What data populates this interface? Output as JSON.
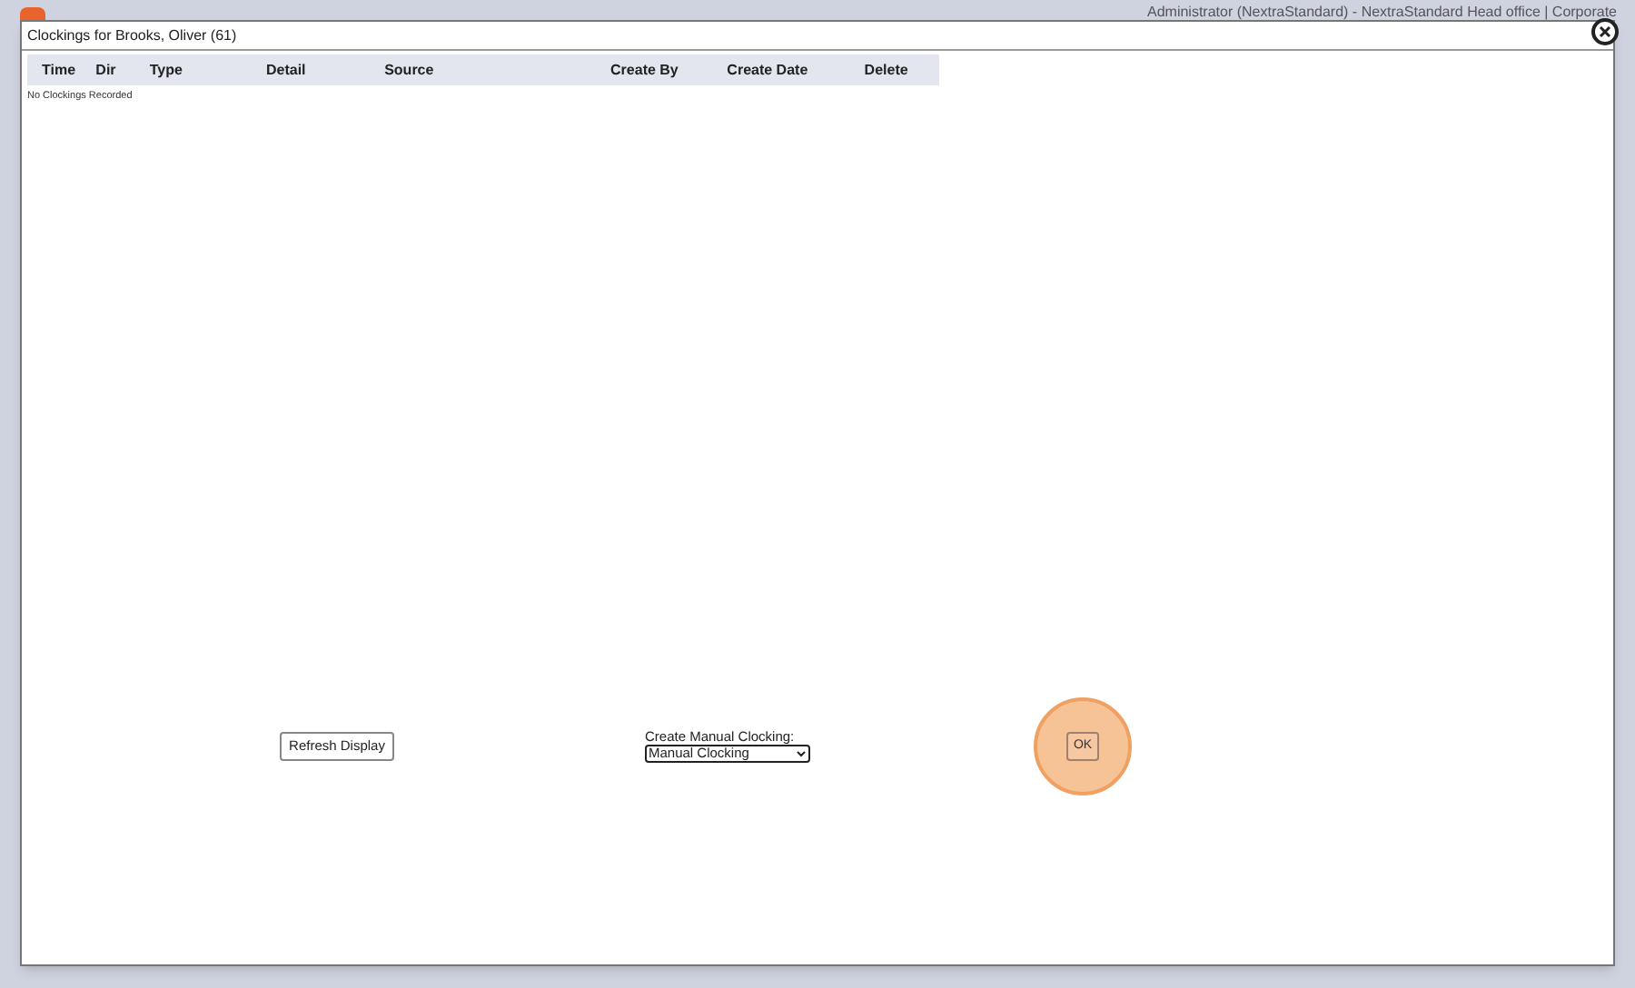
{
  "header": {
    "user": "Administrator (NextraStandard) - NextraStandard Head office | Corporate"
  },
  "dialog": {
    "title": "Clockings for Brooks, Oliver (61)",
    "table": {
      "columns": [
        "Time",
        "Dir",
        "Type",
        "Detail",
        "Source",
        "Create By",
        "Create Date",
        "Delete"
      ],
      "empty_message": "No Clockings Recorded"
    },
    "refresh_button": "Refresh Display",
    "manual": {
      "label": "Create Manual Clocking:",
      "value": "Manual Clocking"
    },
    "ok_button": {
      "label": "OK",
      "highlighted": true
    }
  }
}
